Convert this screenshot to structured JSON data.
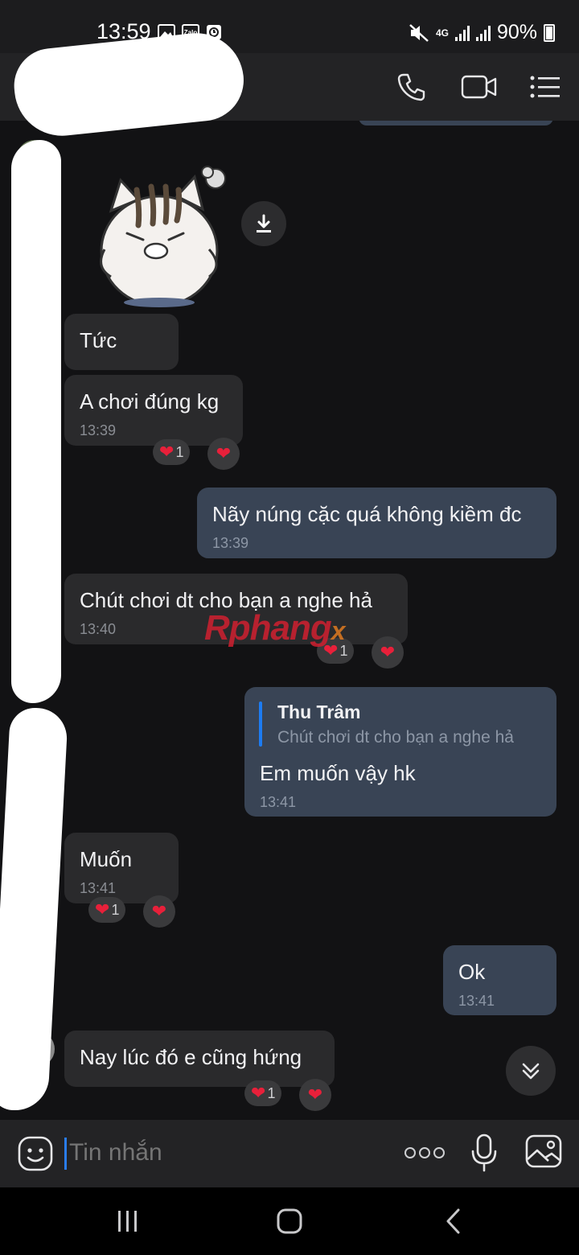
{
  "status_bar": {
    "time": "13:59",
    "network": "4G",
    "battery": "90%",
    "left_icons": [
      "gallery-icon",
      "zalo-icon",
      "clock-icon"
    ],
    "zalo_label": "Zalo"
  },
  "header": {
    "contact_name_redacted": true,
    "actions": [
      "phone-icon",
      "video-icon",
      "menu-icon"
    ]
  },
  "messages": [
    {
      "id": "m1",
      "side": "in",
      "type": "sticker",
      "sticker": "angry-cat-sticker"
    },
    {
      "id": "m2",
      "side": "in",
      "text": "Tức",
      "time": ""
    },
    {
      "id": "m3",
      "side": "in",
      "text": "A chơi đúng kg",
      "time": "13:39",
      "reaction_count": "1"
    },
    {
      "id": "m4",
      "side": "out",
      "text": "Nãy núng cặc quá không kiềm đc",
      "time": "13:39"
    },
    {
      "id": "m5",
      "side": "in",
      "text": "Chút chơi dt cho bạn a nghe hả",
      "time": "13:40",
      "reaction_count": "1"
    },
    {
      "id": "m6",
      "side": "out",
      "quote_author": "Thu Trâm",
      "quote_text": "Chút chơi dt cho bạn a nghe hả",
      "text": "Em muốn vậy hk",
      "time": "13:41"
    },
    {
      "id": "m7",
      "side": "in",
      "text": "Muốn",
      "time": "13:41",
      "reaction_count": "1"
    },
    {
      "id": "m8",
      "side": "out",
      "text": "Ok",
      "time": "13:41"
    },
    {
      "id": "m9",
      "side": "in",
      "text": "Nay lúc đó e cũng hứng",
      "time": "",
      "reaction_count": "1"
    }
  ],
  "watermark": {
    "part1": "Rphang",
    "part2": "x"
  },
  "input": {
    "placeholder": "Tin nhắn"
  },
  "colors": {
    "background": "#121214",
    "incoming_bubble": "#2a2a2c",
    "outgoing_bubble": "#394455",
    "heart": "#e8203a",
    "quote_bar": "#1d7cf2"
  }
}
